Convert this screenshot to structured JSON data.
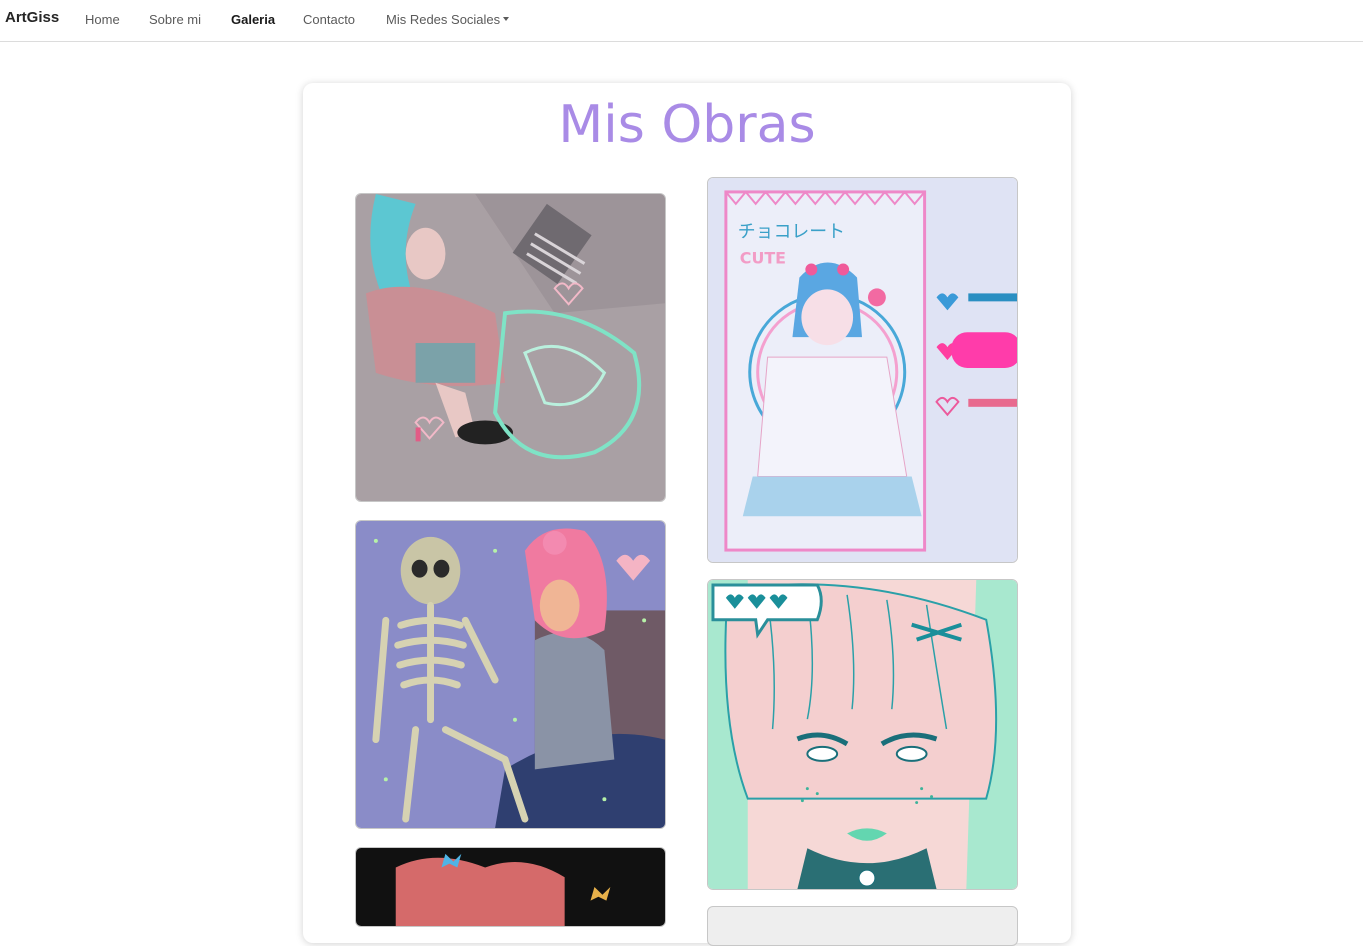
{
  "navbar": {
    "brand": "ArtGiss",
    "links": [
      {
        "label": "Home"
      },
      {
        "label": "Sobre mi"
      },
      {
        "label": "Galeria"
      },
      {
        "label": "Contacto"
      },
      {
        "label": "Mis Redes Sociales"
      }
    ]
  },
  "gallery": {
    "title": "Mis Obras",
    "cute_label": "CUTE",
    "choco_label": "チョコレート"
  },
  "colors": {
    "title": "#a98be6",
    "nav_border": "#dcdcdc"
  }
}
